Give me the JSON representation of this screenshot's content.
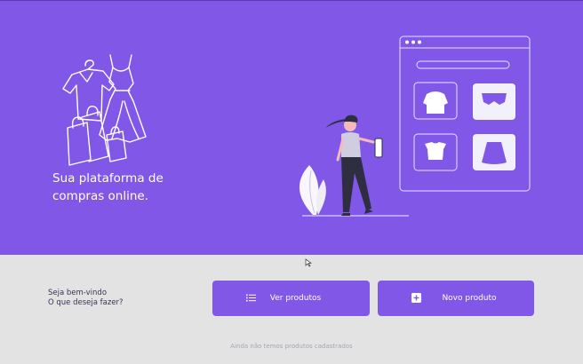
{
  "hero": {
    "tagline_line1": "Sua plataforma de",
    "tagline_line2": "compras online."
  },
  "greeting": {
    "welcome": "Seja bem-vindo",
    "question": "O que deseja fazer?"
  },
  "actions": {
    "view_products_label": "Ver produtos",
    "view_products_icon": "list-icon",
    "new_product_label": "Novo produto",
    "new_product_icon": "plus-square-icon"
  },
  "status": {
    "empty_message": "Ainda não temos produtos cadastrados"
  },
  "colors": {
    "brand": "#8157e8",
    "background": "#e3e3e3",
    "accent_pink": "#f07bb0"
  }
}
